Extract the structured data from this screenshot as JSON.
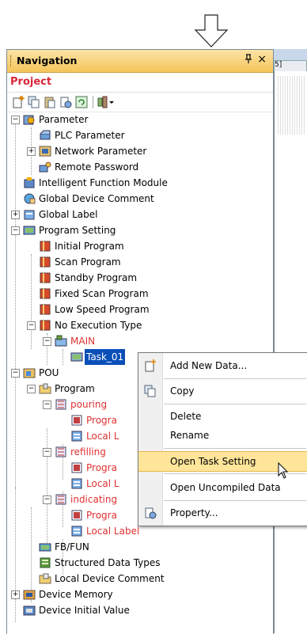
{
  "navigation": {
    "title": "Navigation",
    "pin_label": "ᵖ",
    "close_label": "×",
    "project_label": "Project"
  },
  "editor": {
    "tab_label": "5]"
  },
  "tree": [
    {
      "label": "Parameter",
      "color": "normal"
    },
    {
      "label": "PLC Parameter",
      "color": "normal"
    },
    {
      "label": "Network Parameter",
      "color": "normal"
    },
    {
      "label": "Remote Password",
      "color": "normal"
    },
    {
      "label": "Intelligent Function Module",
      "color": "normal"
    },
    {
      "label": "Global Device Comment",
      "color": "normal"
    },
    {
      "label": "Global Label",
      "color": "normal"
    },
    {
      "label": "Program Setting",
      "color": "normal"
    },
    {
      "label": "Initial Program",
      "color": "normal"
    },
    {
      "label": "Scan Program",
      "color": "normal"
    },
    {
      "label": "Standby Program",
      "color": "normal"
    },
    {
      "label": "Fixed Scan Program",
      "color": "normal"
    },
    {
      "label": "Low Speed Program",
      "color": "normal"
    },
    {
      "label": "No Execution Type",
      "color": "normal"
    },
    {
      "label": "MAIN",
      "color": "red"
    },
    {
      "label": "Task_01",
      "color": "selected"
    },
    {
      "label": "POU",
      "color": "normal"
    },
    {
      "label": "Program",
      "color": "normal"
    },
    {
      "label": "pouring",
      "color": "red"
    },
    {
      "label": "Progra",
      "color": "red"
    },
    {
      "label": "Local L",
      "color": "red"
    },
    {
      "label": "refilling",
      "color": "red"
    },
    {
      "label": "Progra",
      "color": "red"
    },
    {
      "label": "Local L",
      "color": "red"
    },
    {
      "label": "indicating",
      "color": "red"
    },
    {
      "label": "Progra",
      "color": "red"
    },
    {
      "label": "Local Label",
      "color": "red"
    },
    {
      "label": "FB/FUN",
      "color": "normal"
    },
    {
      "label": "Structured Data Types",
      "color": "normal"
    },
    {
      "label": "Local Device Comment",
      "color": "normal"
    },
    {
      "label": "Device Memory",
      "color": "normal"
    },
    {
      "label": "Device Initial Value",
      "color": "normal"
    }
  ],
  "context_menu": {
    "items": [
      {
        "label": "Add New Data...",
        "icon": "add-new-data-icon"
      },
      {
        "label": "Copy",
        "icon": "copy-icon"
      },
      {
        "label": "Delete",
        "icon": ""
      },
      {
        "label": "Rename",
        "icon": ""
      },
      {
        "label": "Open Task Setting",
        "icon": "",
        "highlighted": true
      },
      {
        "label": "Open Uncompiled Data",
        "icon": ""
      },
      {
        "label": "Property...",
        "icon": "property-icon"
      }
    ]
  },
  "colors": {
    "accent_red": "#e03030",
    "selection": "#0a4fb7",
    "menu_highlight": "#ffe59a"
  }
}
